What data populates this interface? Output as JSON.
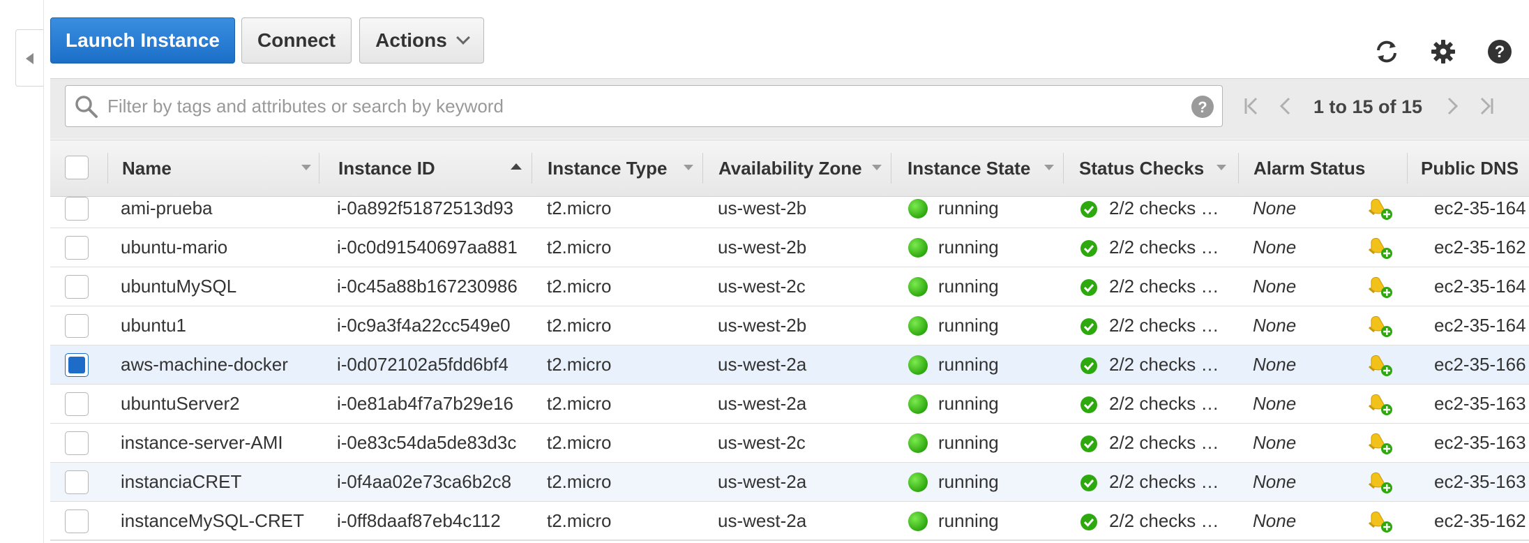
{
  "toolbar": {
    "launch_label": "Launch Instance",
    "connect_label": "Connect",
    "actions_label": "Actions"
  },
  "icons": {
    "refresh": "refresh-icon",
    "settings": "gear-icon",
    "help": "help-icon",
    "search": "search-icon",
    "first_page": "first-page-icon",
    "prev_page": "prev-page-icon",
    "next_page": "next-page-icon",
    "last_page": "last-page-icon"
  },
  "search": {
    "placeholder": "Filter by tags and attributes or search by keyword",
    "value": ""
  },
  "pagination": {
    "text": "1 to 15 of 15"
  },
  "columns": {
    "name": "Name",
    "instance_id": "Instance ID",
    "instance_type": "Instance Type",
    "availability_zone": "Availability Zone",
    "instance_state": "Instance State",
    "status_checks": "Status Checks",
    "alarm_status": "Alarm Status",
    "public_dns": "Public DNS"
  },
  "colors": {
    "primary": "#1c6fc8",
    "running": "#2ea80f",
    "selected_row": "#e9f2fc"
  },
  "rows": [
    {
      "name": "ami-prueba",
      "id": "i-0a892f51872513d93",
      "type": "t2.micro",
      "zone": "us-west-2b",
      "state": "running",
      "checks": "2/2 checks …",
      "alarm": "None",
      "dns": "ec2-35-164",
      "selected": false
    },
    {
      "name": "ubuntu-mario",
      "id": "i-0c0d91540697aa881",
      "type": "t2.micro",
      "zone": "us-west-2b",
      "state": "running",
      "checks": "2/2 checks …",
      "alarm": "None",
      "dns": "ec2-35-162",
      "selected": false
    },
    {
      "name": "ubuntuMySQL",
      "id": "i-0c45a88b167230986",
      "type": "t2.micro",
      "zone": "us-west-2c",
      "state": "running",
      "checks": "2/2 checks …",
      "alarm": "None",
      "dns": "ec2-35-164",
      "selected": false
    },
    {
      "name": "ubuntu1",
      "id": "i-0c9a3f4a22cc549e0",
      "type": "t2.micro",
      "zone": "us-west-2b",
      "state": "running",
      "checks": "2/2 checks …",
      "alarm": "None",
      "dns": "ec2-35-164",
      "selected": false
    },
    {
      "name": "aws-machine-docker",
      "id": "i-0d072102a5fdd6bf4",
      "type": "t2.micro",
      "zone": "us-west-2a",
      "state": "running",
      "checks": "2/2 checks …",
      "alarm": "None",
      "dns": "ec2-35-166",
      "selected": true
    },
    {
      "name": "ubuntuServer2",
      "id": "i-0e81ab4f7a7b29e16",
      "type": "t2.micro",
      "zone": "us-west-2a",
      "state": "running",
      "checks": "2/2 checks …",
      "alarm": "None",
      "dns": "ec2-35-163",
      "selected": false
    },
    {
      "name": "instance-server-AMI",
      "id": "i-0e83c54da5de83d3c",
      "type": "t2.micro",
      "zone": "us-west-2c",
      "state": "running",
      "checks": "2/2 checks …",
      "alarm": "None",
      "dns": "ec2-35-163",
      "selected": false
    },
    {
      "name": "instanciaCRET",
      "id": "i-0f4aa02e73ca6b2c8",
      "type": "t2.micro",
      "zone": "us-west-2a",
      "state": "running",
      "checks": "2/2 checks …",
      "alarm": "None",
      "dns": "ec2-35-163",
      "selected": false,
      "hover": true
    },
    {
      "name": "instanceMySQL-CRET",
      "id": "i-0ff8daaf87eb4c112",
      "type": "t2.micro",
      "zone": "us-west-2a",
      "state": "running",
      "checks": "2/2 checks …",
      "alarm": "None",
      "dns": "ec2-35-162",
      "selected": false
    }
  ]
}
